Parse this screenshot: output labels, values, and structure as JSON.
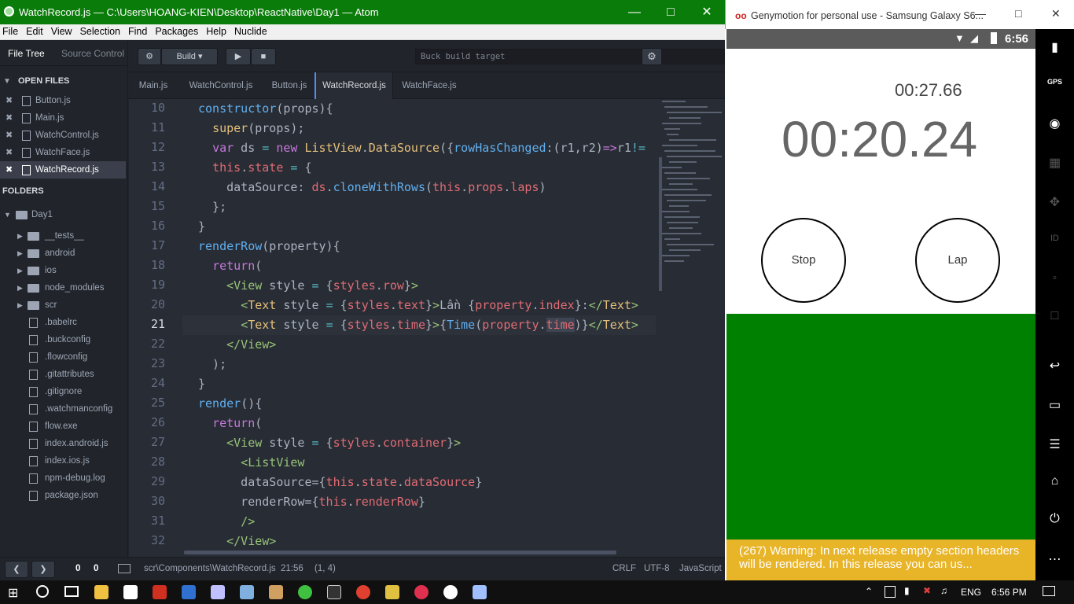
{
  "atom": {
    "title": "WatchRecord.js — C:\\Users\\HOANG-KIEN\\Desktop\\ReactNative\\Day1 — Atom",
    "menu": [
      "File",
      "Edit",
      "View",
      "Selection",
      "Find",
      "Packages",
      "Help",
      "Nuclide"
    ],
    "panel_tabs": {
      "file_tree": "File Tree",
      "source_control": "Source Control"
    },
    "open_files_header": "OPEN FILES",
    "open_files": [
      "Button.js",
      "Main.js",
      "WatchControl.js",
      "WatchFace.js",
      "WatchRecord.js"
    ],
    "folders_header": "FOLDERS",
    "project": "Day1",
    "folders": [
      "__tests__",
      "android",
      "ios",
      "node_modules",
      "scr"
    ],
    "files": [
      ".babelrc",
      ".buckconfig",
      ".flowconfig",
      ".gitattributes",
      ".gitignore",
      ".watchmanconfig",
      "flow.exe",
      "index.android.js",
      "index.ios.js",
      "npm-debug.log",
      "package.json"
    ],
    "toolbar": {
      "build_label": "Build",
      "buck_placeholder": "Buck build target"
    },
    "tabs": [
      "Main.js",
      "WatchControl.js",
      "Button.js",
      "WatchRecord.js",
      "WatchFace.js"
    ],
    "active_tab": "WatchRecord.js",
    "line_numbers": [
      "10",
      "11",
      "12",
      "13",
      "14",
      "15",
      "16",
      "17",
      "18",
      "19",
      "20",
      "21",
      "22",
      "23",
      "24",
      "25",
      "26",
      "27",
      "28",
      "29",
      "30",
      "31",
      "32"
    ],
    "current_line": "21",
    "status": {
      "counts_a": "0",
      "counts_b": "0",
      "path": "scr\\Components\\WatchRecord.js",
      "pos": "21:56",
      "sel": "(1, 4)",
      "eol": "CRLF",
      "enc": "UTF-8",
      "grammar": "JavaScript"
    }
  },
  "emulator": {
    "title": "Genymotion for personal use - Samsung Galaxy S6...",
    "clock": "6:56",
    "lap_time": "00:27.66",
    "main_time": "00:20.24",
    "stop_label": "Stop",
    "lap_label": "Lap",
    "warning_text": "(267) Warning: In next release empty section headers will be rendered. In this release you can us..."
  },
  "taskbar": {
    "lang": "ENG",
    "time": "6:56 PM"
  },
  "colors": {
    "titlebar": "#0a7c0a",
    "app_green": "#008000",
    "warning": "#e8b428"
  }
}
